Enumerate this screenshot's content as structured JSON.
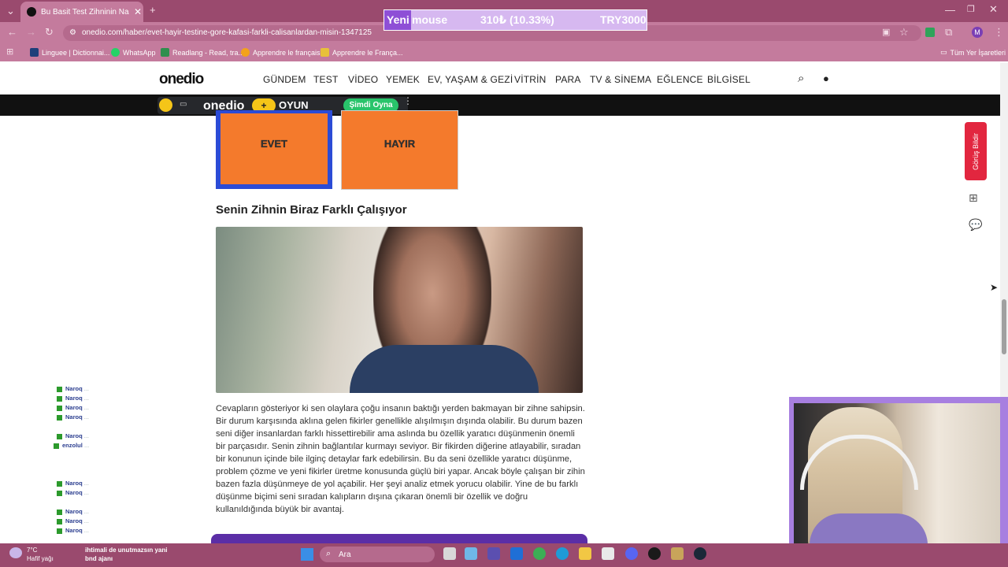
{
  "browser": {
    "tab_title": "Bu Basit Test Zihninin Nasıl Çalış",
    "url": "onedio.com/haber/evet-hayir-testine-gore-kafasi-farkli-calisanlardan-misin-1347125",
    "bookmarks": [
      "Linguee | Dictionnai...",
      "WhatsApp",
      "Readlang - Read, tra...",
      "Apprendre le français",
      "Apprendre le França..."
    ],
    "all_bookmarks": "Tüm Yer İşaretleri",
    "profile_initial": "M"
  },
  "overlay": {
    "label_new": "Yeni",
    "label_item": "mouse",
    "progress": "310₺ (10.33%)",
    "goal": "TRY3000",
    "progress_fraction": 0.1033
  },
  "site": {
    "logo": "onedio",
    "nav": [
      "GÜNDEM",
      "TEST",
      "VİDEO",
      "YEMEK",
      "EV, YAŞAM & GEZİ",
      "VİTRİN",
      "PARA",
      "TV & SİNEMA",
      "EĞLENCE",
      "BİLGİSEL"
    ],
    "game": {
      "logo": "onedio",
      "oyun": "OYUN",
      "play": "Şimdi Oyna"
    }
  },
  "quiz": {
    "answers": [
      "EVET",
      "HAYIR"
    ],
    "selected": "EVET"
  },
  "result": {
    "heading": "Senin Zihnin Biraz Farklı Çalışıyor",
    "text": "Cevapların gösteriyor ki sen olaylara çoğu insanın baktığı yerden bakmayan bir zihne sahipsin. Bir durum karşısında aklına gelen fikirler genellikle alışılmışın dışında olabilir. Bu durum bazen seni diğer insanlardan farklı hissettirebilir ama aslında bu özellik yaratıcı düşünmenin önemli bir parçasıdır. Senin zihnin bağlantılar kurmayı seviyor. Bir fikirden diğerine atlayabilir, sıradan bir konunun içinde bile ilginç detaylar fark edebilirsin. Bu da seni özellikle yaratıcı düşünme, problem çözme ve yeni fikirler üretme konusunda güçlü biri yapar. Ancak böyle çalışan bir zihin bazen fazla düşünmeye de yol açabilir. Her şeyi analiz etmek yorucu olabilir. Yine de bu farklı düşünme biçimi seni sıradan kalıpların dışına çıkaran önemli bir özellik ve doğru kullanıldığında büyük bir avantaj."
  },
  "sidebar": {
    "feedback": "Görüş Bildir"
  },
  "chat": [
    {
      "user": "Naroq",
      "msg": "..."
    },
    {
      "user": "Naroq",
      "msg": "..."
    },
    {
      "user": "Naroq",
      "msg": "..."
    },
    {
      "user": "Naroq",
      "msg": "..."
    },
    {
      "user": "Naroq",
      "msg": "..."
    },
    {
      "user": "enzolul",
      "msg": "..."
    },
    {
      "user": "Naroq",
      "msg": "..."
    },
    {
      "user": "Naroq",
      "msg": "..."
    },
    {
      "user": "Naroq",
      "msg": "..."
    },
    {
      "user": "Naroq",
      "msg": "..."
    },
    {
      "user": "Naroq",
      "msg": "..."
    }
  ],
  "taskbar": {
    "temp": "7°C",
    "weather": "Hafif yağı",
    "search": "Ara",
    "notice_line1": "ihtimali de unutmazsın yani",
    "notice_line2": "bnd ajanı"
  }
}
